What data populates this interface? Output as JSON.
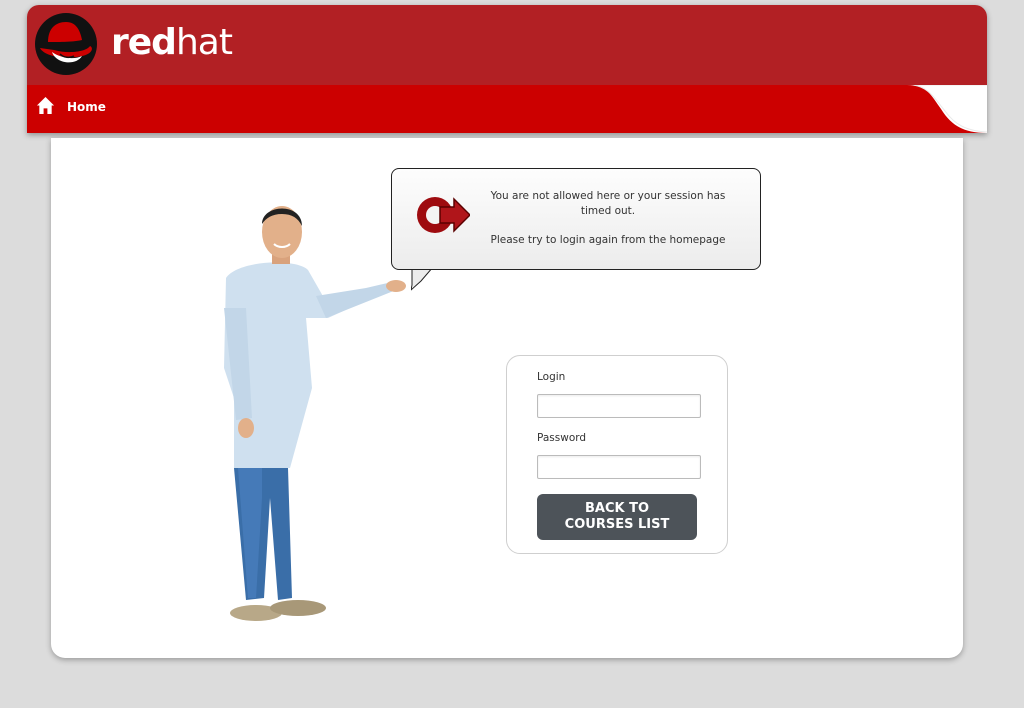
{
  "brand": {
    "text_red": "red",
    "text_hat": "hat",
    "header_color": "#b22024",
    "nav_color": "#cc0000"
  },
  "nav": {
    "home_label": "Home",
    "home_icon": "home-icon"
  },
  "bubble": {
    "icon": "logout-arrow-icon",
    "message_line1": "You are not allowed here or your session has timed out.",
    "message_line2": "Please try to login again from the homepage"
  },
  "login_form": {
    "login_label": "Login",
    "login_value": "",
    "password_label": "Password",
    "password_value": "",
    "back_button_label": "BACK TO\nCOURSES LIST",
    "button_color": "#4d5359"
  }
}
